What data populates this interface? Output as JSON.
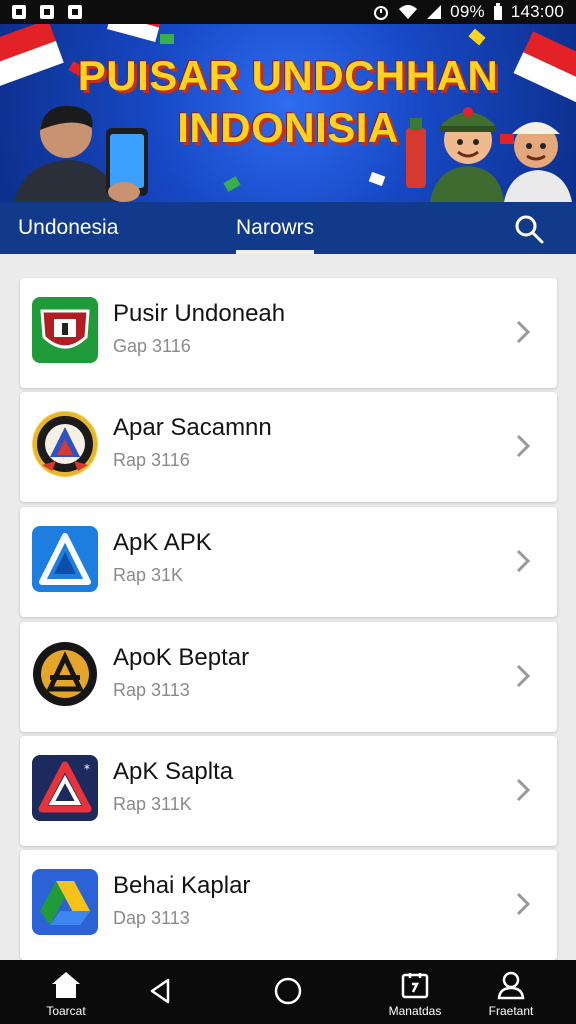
{
  "status_bar": {
    "battery": "09%",
    "time": "143:00"
  },
  "banner": {
    "title_line1": "PUISAR UNDCHHAN",
    "title_line2": "INDONISIA"
  },
  "tabs": [
    {
      "label": "Undonesia"
    },
    {
      "label": "Narowrs"
    }
  ],
  "apps": [
    {
      "title": "Pusir Undoneah",
      "subtitle": "Gap 3116",
      "icon": "shield-icon"
    },
    {
      "title": "Apar Sacamnn",
      "subtitle": "Rap 3116",
      "icon": "emblem-icon"
    },
    {
      "title": "ApK APK",
      "subtitle": "Rap 31K",
      "icon": "triangle-icon"
    },
    {
      "title": "ApoK Beptar",
      "subtitle": "Rap 3113",
      "icon": "seal-icon"
    },
    {
      "title": "ApK Saplta",
      "subtitle": "Rap 311K",
      "icon": "penrose-icon"
    },
    {
      "title": "Behai Kaplar",
      "subtitle": "Dap 3113",
      "icon": "drive-icon"
    }
  ],
  "bottom_nav": [
    {
      "label": "Toarcat",
      "icon": "home-icon"
    },
    {
      "label": "",
      "icon": "back-icon"
    },
    {
      "label": "",
      "icon": "circle-home-icon"
    },
    {
      "label": "Manatdas",
      "icon": "calendar-icon"
    },
    {
      "label": "Fraetant",
      "icon": "profile-icon"
    }
  ],
  "colors": {
    "tab_bar": "#123a8a",
    "banner_blue": "#1748c4",
    "title_yellow": "#ffd320",
    "nav_bg": "#0b0b0b"
  }
}
